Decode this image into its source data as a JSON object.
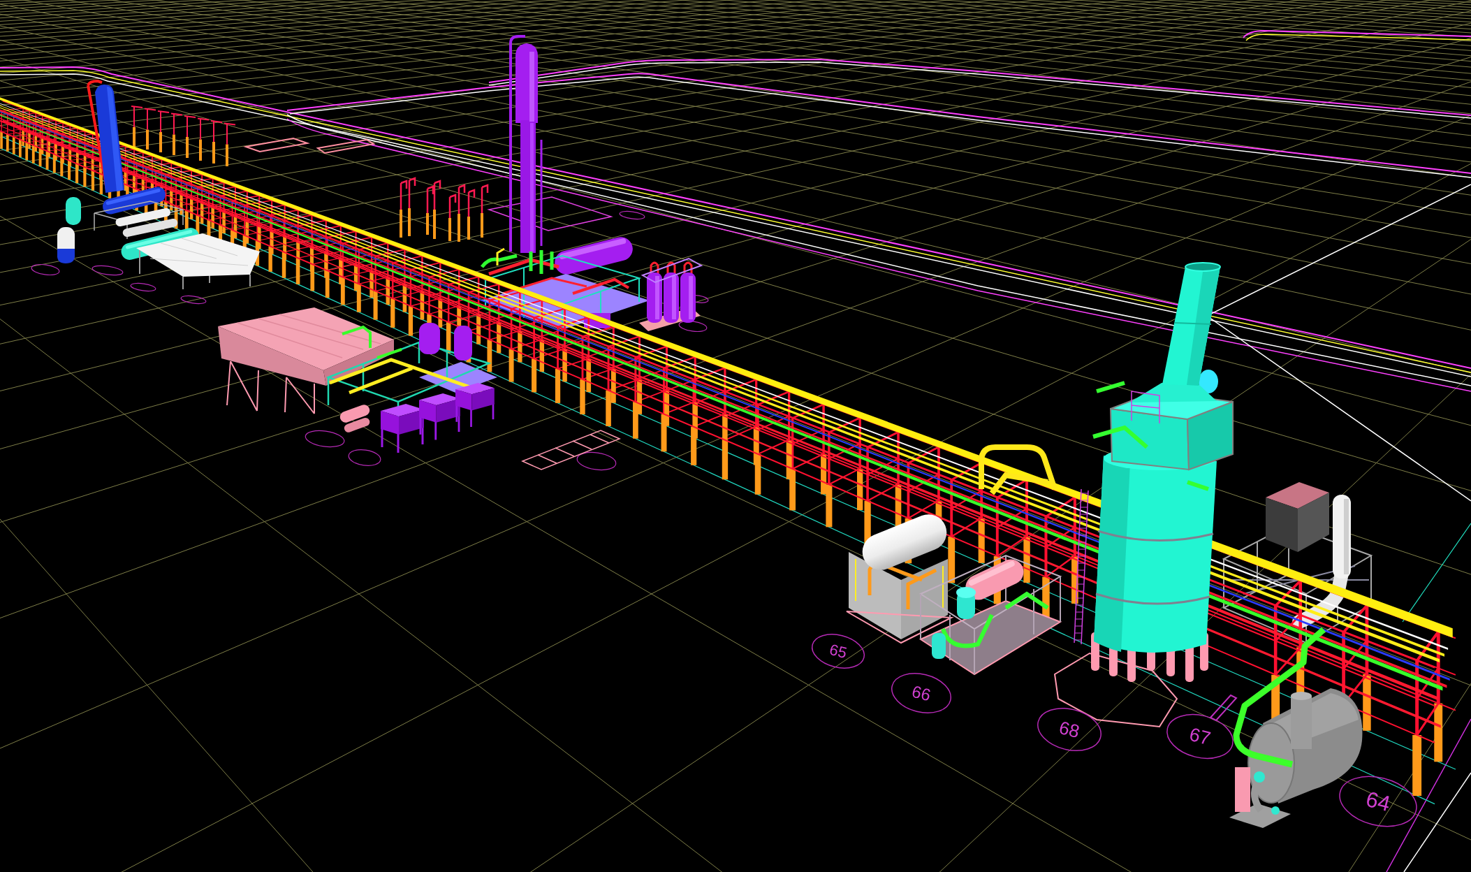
{
  "model_view": {
    "area_tags": [
      {
        "label": "65"
      },
      {
        "label": "66"
      },
      {
        "label": "68"
      },
      {
        "label": "67"
      },
      {
        "label": "64"
      }
    ]
  }
}
